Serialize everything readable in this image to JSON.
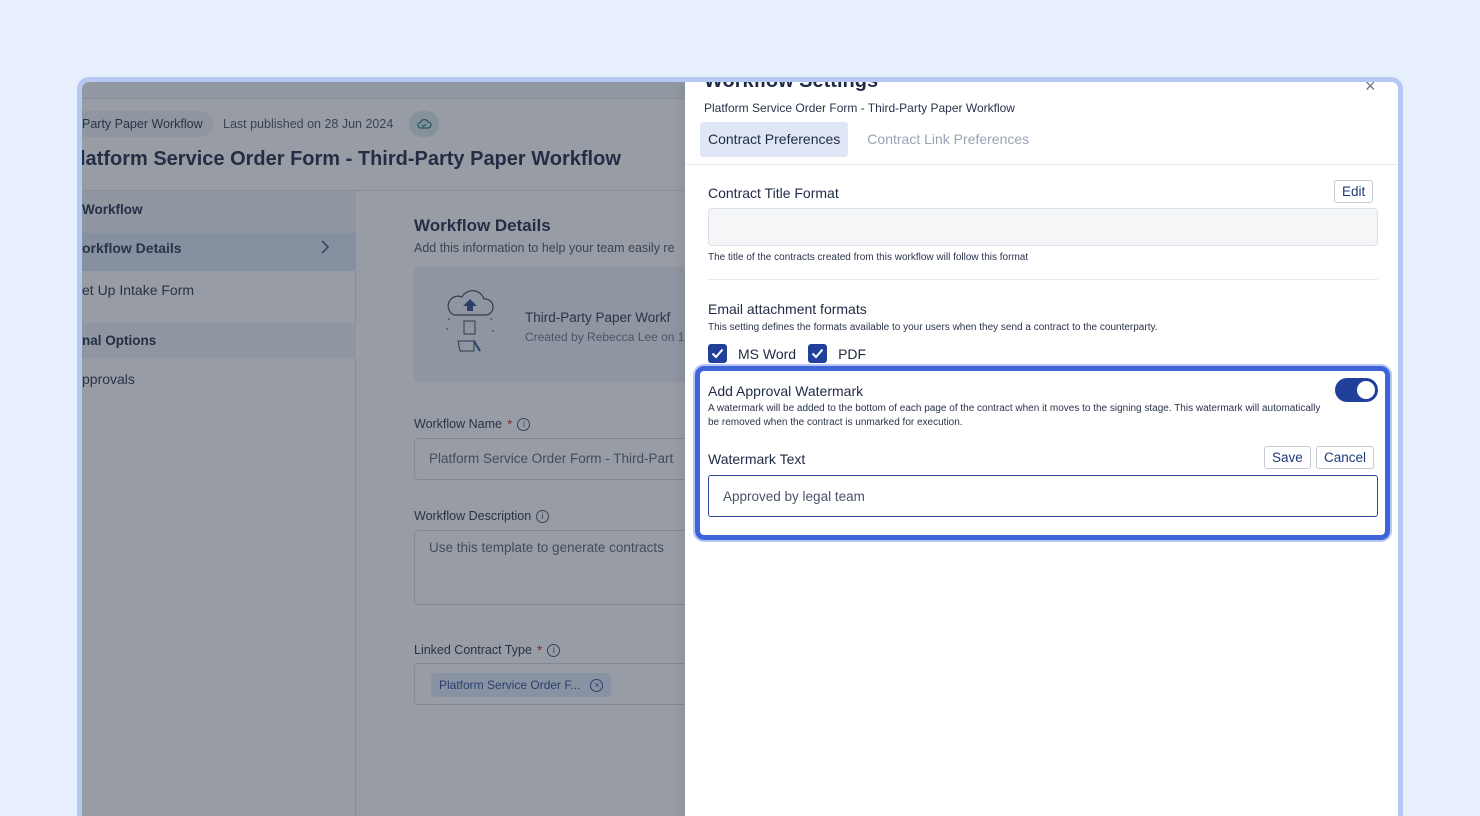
{
  "page": {
    "breadcrumb_pill": "Party Paper Workflow",
    "last_published": "Last published on 28 Jun 2024",
    "title": "latform Service Order Form - Third-Party Paper Workflow",
    "sidebar": {
      "group_workflow": "Workflow",
      "item_workflow_details": "orkflow Details",
      "item_intake_form": "et Up Intake Form",
      "group_optional": "nal Options",
      "item_approvals": "pprovals"
    },
    "content": {
      "title": "Workflow Details",
      "subtitle": "Add this information to help your team easily re",
      "card_title": "Third-Party Paper Workf",
      "card_sub": "Created by Rebecca Lee on 1",
      "workflow_name_label": "Workflow Name",
      "workflow_name_value": "Platform Service Order Form - Third-Part",
      "workflow_desc_label": "Workflow Description",
      "workflow_desc_value": "Use this template to generate contracts",
      "linked_type_label": "Linked Contract Type",
      "linked_type_chip": "Platform Service Order F...",
      "required_mark": "*",
      "info_glyph": "i",
      "chip_close_glyph": "×"
    }
  },
  "drawer": {
    "title": "Workflow Settings",
    "close_glyph": "×",
    "subtitle": "Platform Service Order Form - Third-Party Paper Workflow",
    "tabs": [
      {
        "label": "Contract Preferences",
        "active": true
      },
      {
        "label": "Contract Link Preferences",
        "active": false
      }
    ],
    "contract_title": {
      "label": "Contract Title Format",
      "edit_label": "Edit",
      "hint": "The title of the contracts created from this workflow will follow this format"
    },
    "email": {
      "label": "Email attachment formats",
      "hint": "This setting defines the formats available to your users when they send a contract to the counterparty.",
      "options": [
        {
          "label": "MS Word",
          "checked": true
        },
        {
          "label": "PDF",
          "checked": true
        }
      ]
    },
    "watermark": {
      "label": "Add Approval Watermark",
      "enabled": true,
      "description": "A watermark will be added to the bottom of each page of the contract when it moves to the signing stage. This watermark will automatically be removed when the contract is unmarked for execution.",
      "text_label": "Watermark Text",
      "save_label": "Save",
      "cancel_label": "Cancel",
      "text_value": "Approved by legal team"
    }
  },
  "colors": {
    "accent": "#21409a",
    "highlight": "#3f63d8",
    "background": "#e9f0fd"
  }
}
